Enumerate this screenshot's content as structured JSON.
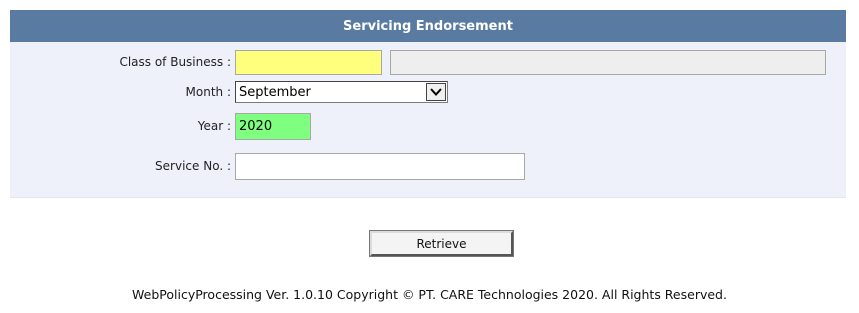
{
  "panel": {
    "title": "Servicing Endorsement"
  },
  "form": {
    "class_of_business": {
      "label": "Class of Business :",
      "code_value": "",
      "description_value": ""
    },
    "month": {
      "label": "Month :",
      "selected": "September"
    },
    "year": {
      "label": "Year :",
      "value": "2020"
    },
    "service_no": {
      "label": "Service No. :",
      "value": ""
    }
  },
  "actions": {
    "retrieve_label": "Retrieve"
  },
  "footer": {
    "text": "WebPolicyProcessing Ver. 1.0.10 Copyright © PT. CARE Technologies 2020. All Rights Reserved."
  },
  "colors": {
    "header_bg": "#5a7ba1",
    "body_bg": "#eef1fa",
    "required_field": "#ffff7e",
    "valid_field": "#7fff7f",
    "readonly_field": "#eeeeee"
  },
  "icons": {
    "dropdown": "chevron-down-icon"
  }
}
